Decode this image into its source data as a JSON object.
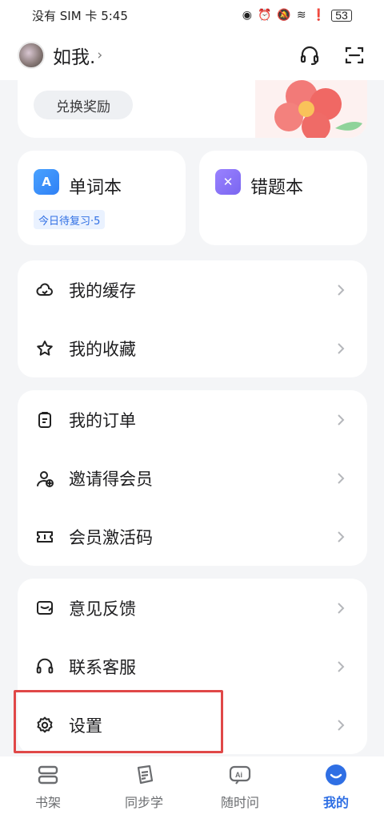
{
  "status_bar": {
    "carrier_time": "没有 SIM 卡 5:45",
    "battery": "53"
  },
  "header": {
    "username": "如我."
  },
  "reward": {
    "button_label": "兑换奖励"
  },
  "cards": {
    "wordbook": {
      "title": "单词本",
      "badge": "今日待复习·5",
      "icon": "A"
    },
    "wrongbook": {
      "title": "错题本",
      "icon": "✕"
    }
  },
  "menu": {
    "group1": [
      "我的缓存",
      "我的收藏"
    ],
    "group2": [
      "我的订单",
      "邀请得会员",
      "会员激活码"
    ],
    "group3": [
      "意见反馈",
      "联系客服",
      "设置"
    ]
  },
  "tabbar": {
    "items": [
      {
        "label": "书架",
        "icon": "bookshelf-icon"
      },
      {
        "label": "同步学",
        "icon": "sync-study-icon"
      },
      {
        "label": "随时问",
        "icon": "ai-ask-icon"
      },
      {
        "label": "我的",
        "icon": "profile-icon"
      }
    ],
    "active_index": 3
  },
  "colors": {
    "accent": "#2f6fe4",
    "highlight": "#e04848"
  }
}
